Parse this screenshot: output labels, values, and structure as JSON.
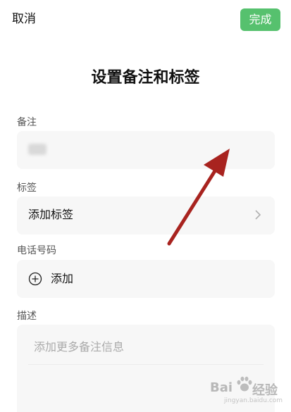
{
  "header": {
    "cancel_label": "取消",
    "done_label": "完成",
    "done_color": "#56c16e"
  },
  "title": "设置备注和标签",
  "remark": {
    "label": "备注",
    "value": "123"
  },
  "tags": {
    "label": "标签",
    "add_label": "添加标签"
  },
  "phone": {
    "label": "电话号码",
    "add_label": "添加"
  },
  "description": {
    "label": "描述",
    "placeholder": "添加更多备注信息"
  },
  "annotation": {
    "arrow_color": "#a8231f"
  },
  "watermark": {
    "brand_left": "Bai",
    "brand_right": "经验",
    "url": "jingyan.baidu.com"
  }
}
